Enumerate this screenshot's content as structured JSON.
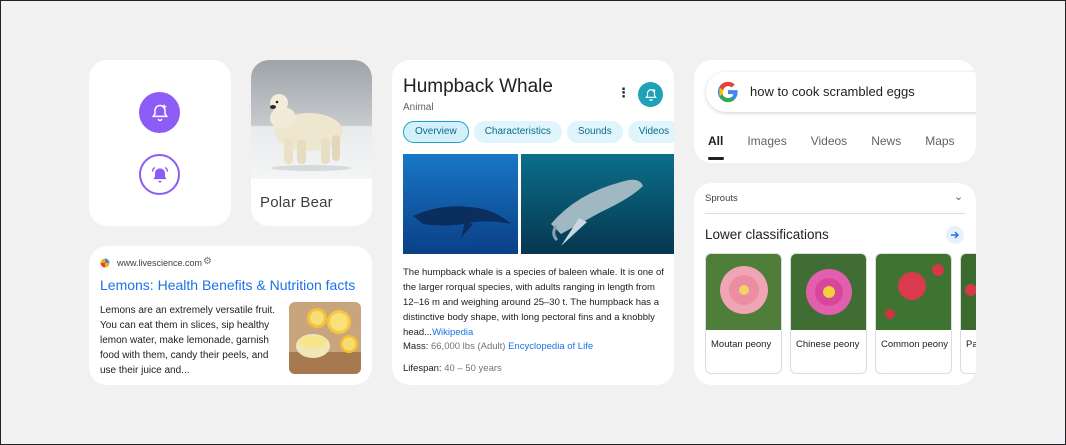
{
  "colors": {
    "accent_purple": "#8b5cf6",
    "accent_teal": "#1fa1b8",
    "link_blue": "#1a73e8",
    "chip_bg": "#dff4fb"
  },
  "bell_card": {
    "icons": [
      "bell-add-icon",
      "bell-ringing-icon"
    ]
  },
  "polar_bear": {
    "title": "Polar Bear"
  },
  "lemons": {
    "site": "www.livescience.com",
    "title": "Lemons: Health Benefits & Nutrition facts",
    "snippet": "Lemons are an extremely versatile fruit. You can eat them in slices, sip healthy lemon water, make lemonade, garnish food with them, candy their peels, and use their juice and..."
  },
  "whale": {
    "title": "Humpback Whale",
    "subtitle": "Animal",
    "chips": [
      "Overview",
      "Characteristics",
      "Sounds",
      "Videos"
    ],
    "description": "The humpback whale is a species of baleen whale. It is one of the larger rorqual species, with adults ranging in length from 12–16 m and weighing around 25–30 t. The humpback has a distinctive body shape, with long pectoral fins and a knobbly head...",
    "description_link": "Wikipedia",
    "mass_label": "Mass:",
    "mass_value": "66,000 lbs (Adult)",
    "mass_link": "Encyclopedia of Life",
    "lifespan_label": "Lifespan:",
    "lifespan_value": "40 – 50 years"
  },
  "search": {
    "query": "how to cook scrambled eggs",
    "tabs": [
      "All",
      "Images",
      "Videos",
      "News",
      "Maps"
    ]
  },
  "sprouts": {
    "label": "Sprouts",
    "section_title": "Lower classifications",
    "items": [
      {
        "name": "Moutan peony"
      },
      {
        "name": "Chinese peony"
      },
      {
        "name": "Common peony"
      },
      {
        "name": "Pa te"
      }
    ]
  }
}
